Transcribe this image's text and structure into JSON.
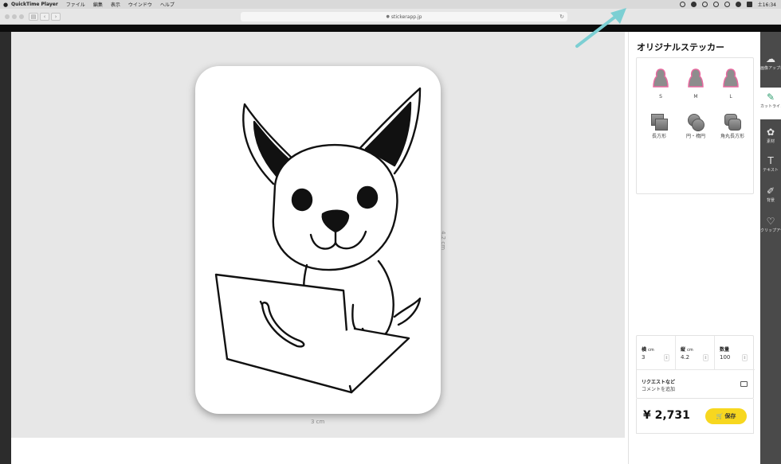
{
  "menubar": {
    "app_name": "QuickTime Player",
    "items": [
      "ファイル",
      "編集",
      "表示",
      "ウインドウ",
      "ヘルプ"
    ],
    "clock": "土16:34"
  },
  "browser": {
    "url": "stickerapp.jp"
  },
  "canvas": {
    "height_label": "4.2 cm",
    "width_label": "3 cm"
  },
  "panel": {
    "title": "オリジナルステッカー",
    "sizes": [
      {
        "label": "S"
      },
      {
        "label": "M"
      },
      {
        "label": "L"
      }
    ],
    "shapes": [
      {
        "label": "長方形"
      },
      {
        "label": "円・楕円"
      },
      {
        "label": "角丸長方形"
      }
    ],
    "spec": {
      "width_label": "横",
      "width_unit": "cm",
      "width_value": "3",
      "height_label": "縦",
      "height_unit": "cm",
      "height_value": "4.2",
      "qty_label": "数量",
      "qty_value": "100"
    },
    "request_title": "リクエストなど",
    "request_sub": "コメントを追加",
    "price": "¥ 2,731",
    "save_label": "保存"
  },
  "tools": [
    {
      "label": "画像アップロード",
      "icon": "cloud-upload-icon"
    },
    {
      "label": "カットライン",
      "icon": "pen-icon"
    },
    {
      "label": "素材",
      "icon": "paw-icon"
    },
    {
      "label": "テキスト",
      "icon": "text-icon"
    },
    {
      "label": "背景",
      "icon": "brush-icon"
    },
    {
      "label": "クリップアート",
      "icon": "heart-icon"
    }
  ],
  "colors": {
    "accent_yellow": "#f7d71f",
    "active_green": "#2f9e6f",
    "arrow_teal": "#7ccfd3"
  }
}
